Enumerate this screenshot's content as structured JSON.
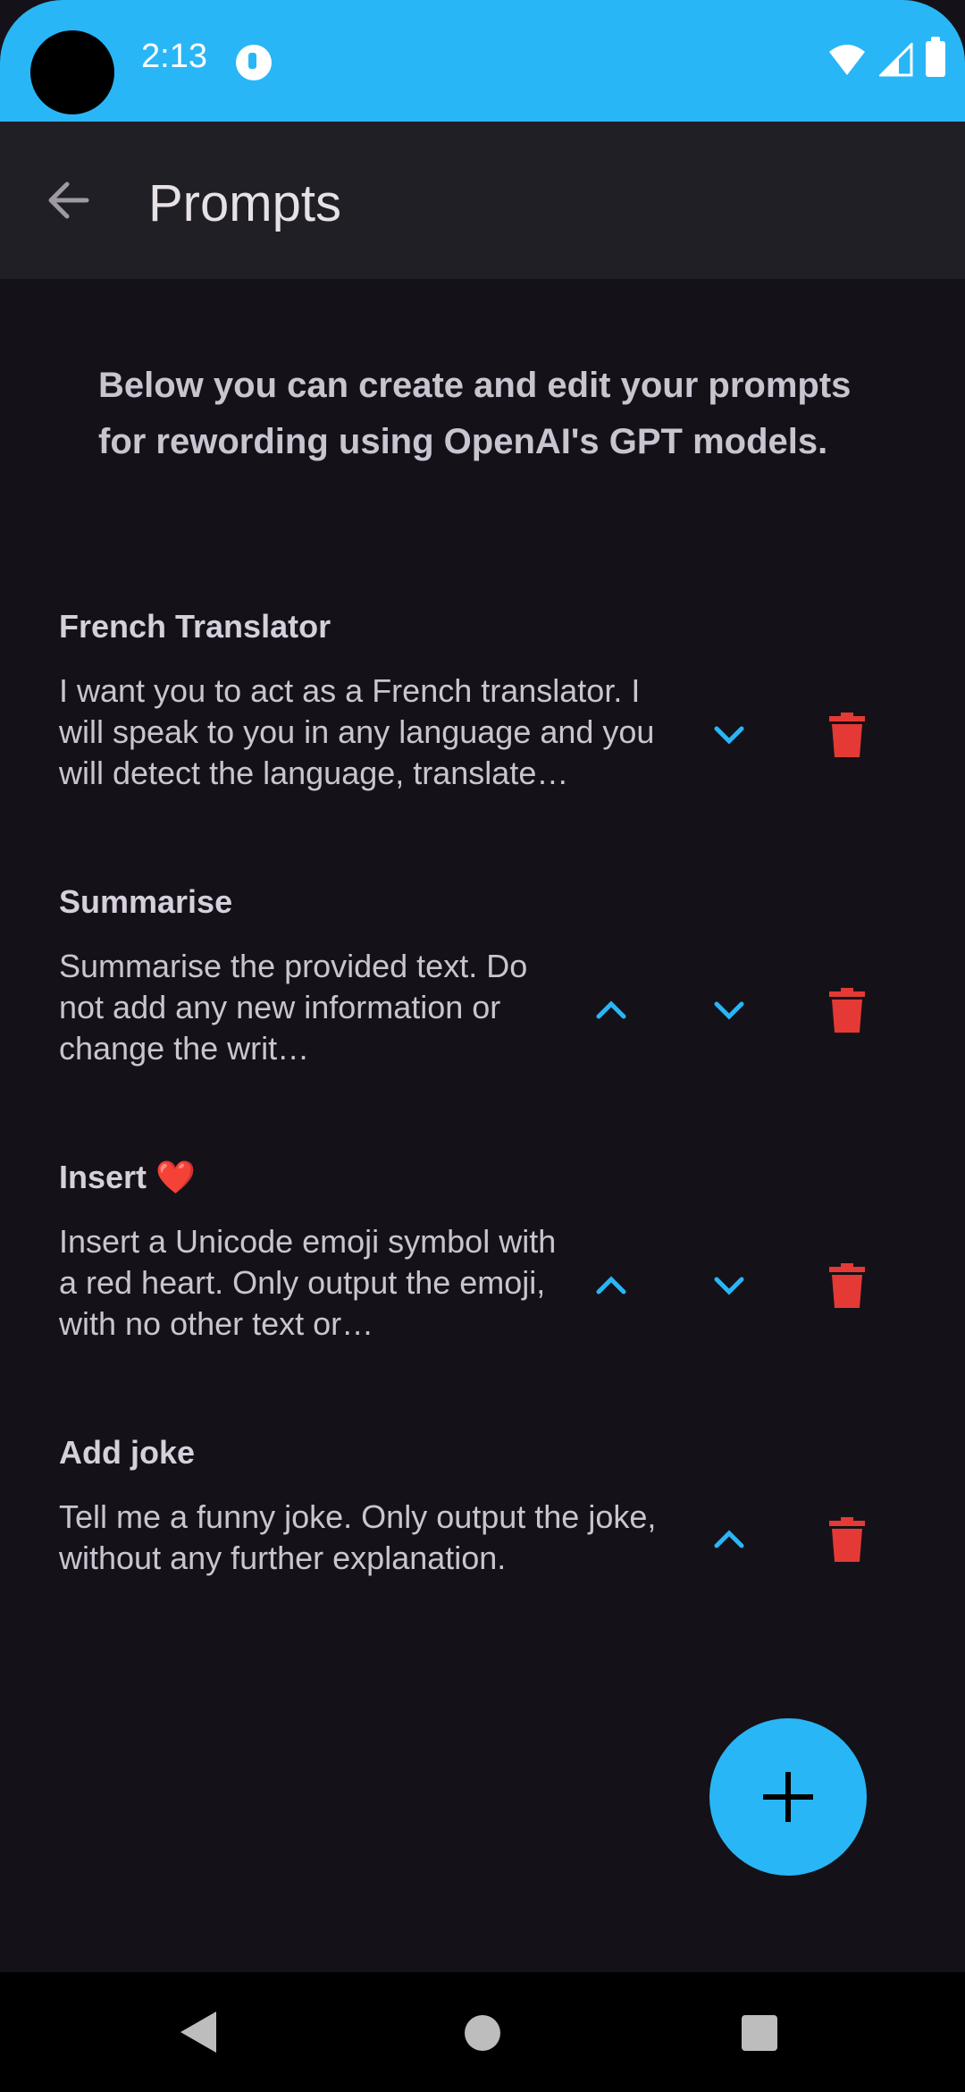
{
  "status_bar": {
    "time": "2:13",
    "icons": [
      "camera-cutout",
      "notification-app-icon",
      "wifi-icon",
      "cell-signal-icon",
      "battery-icon"
    ],
    "color": "#29b6f6"
  },
  "app_bar": {
    "back_icon": "arrow-back-icon",
    "title": "Prompts"
  },
  "intro_text": "Below you can create and edit your prompts for rewording using OpenAI's GPT models.",
  "prompts": [
    {
      "title": "French Translator",
      "text": "I want you to act as a French translator. I will speak to you in any language and you will detect the language, translate…"
    },
    {
      "title": "Summarise",
      "text": "Summarise the provided text. Do not add any new information or change the writ…"
    },
    {
      "title": "Insert ❤️",
      "text": "Insert a Unicode emoji symbol with a red heart. Only output the emoji, with no other text or…"
    },
    {
      "title": "Add joke",
      "text": "Tell me a funny joke. Only output the joke, without any further explanation."
    }
  ],
  "colors": {
    "accent": "#29b6f6",
    "delete": "#e53935",
    "background": "#141218",
    "app_bar": "#211f26"
  },
  "fab": {
    "icon": "plus-icon"
  },
  "nav_bar": {
    "icons": [
      "nav-back-icon",
      "nav-home-icon",
      "nav-recents-icon"
    ]
  }
}
